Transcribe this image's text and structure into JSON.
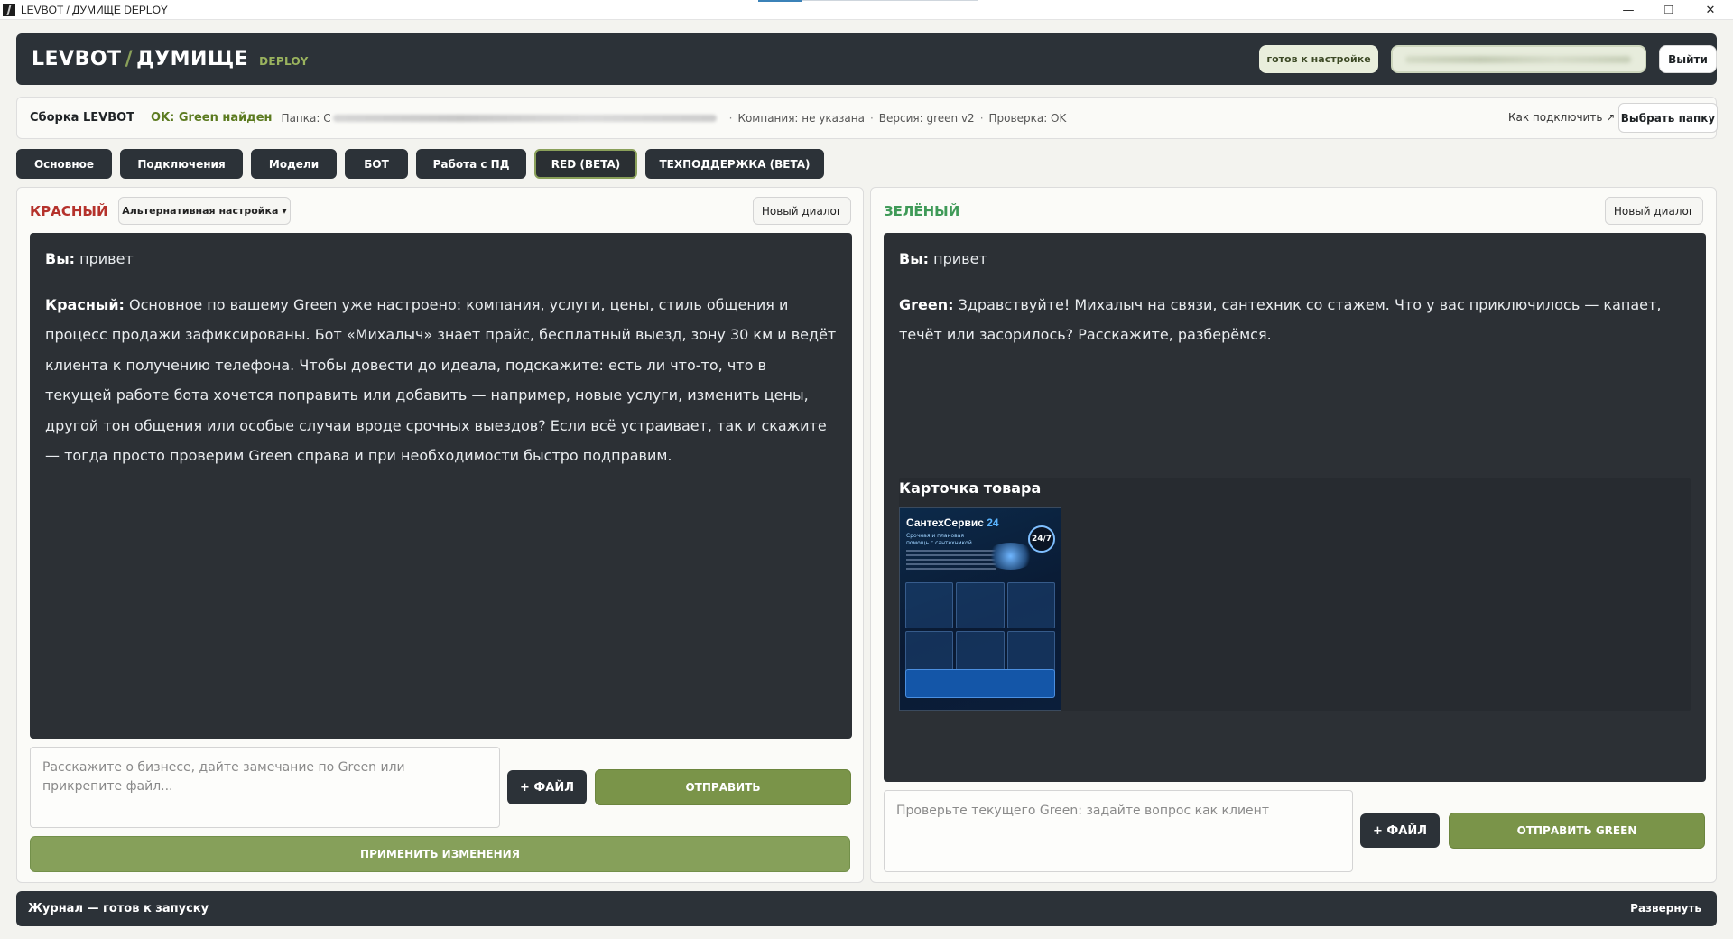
{
  "window": {
    "title": "LEVBOT / ДУМИЩЕ DEPLOY",
    "minimize": "—",
    "restore": "❐",
    "close": "✕"
  },
  "header": {
    "brand_left": "LEVBOT",
    "brand_slash": "/",
    "brand_right": "ДУМИЩЕ",
    "tag": "DEPLOY",
    "status": "готов к настройке",
    "logout": "Выйти"
  },
  "build": {
    "title": "Сборка LEVBOT",
    "ok": "OK: Green найден",
    "folder_label": "Папка: C",
    "company": "Компания: не указана",
    "version": "Версия: green v2",
    "check": "Проверка: OK",
    "how_link": "Как подключить ↗",
    "pick_folder": "Выбрать папку"
  },
  "tabs": [
    {
      "label": "Основное"
    },
    {
      "label": "Подключения"
    },
    {
      "label": "Модели"
    },
    {
      "label": "БОТ"
    },
    {
      "label": "Работа с ПД"
    },
    {
      "label": "RED (BETA)"
    },
    {
      "label": "ТЕХПОДДЕРЖКА (BETA)"
    }
  ],
  "red_panel": {
    "title": "КРАСНЫЙ",
    "alt_setting": "Альтернативная настройка ▾",
    "new_dialog": "Новый диалог",
    "messages": [
      {
        "speaker": "Вы:",
        "text": " привет"
      },
      {
        "speaker": "Красный:",
        "text": " Основное по вашему Green уже настроено: компания, услуги, цены, стиль общения и процесс продажи зафиксированы. Бот «Михалыч» знает прайс, бесплатный выезд, зону 30 км и ведёт клиента к получению телефона. Чтобы довести до идеала, подскажите: есть ли что-то, что в текущей работе бота хочется поправить или добавить — например, новые услуги, изменить цены, другой тон общения или особые случаи вроде срочных выездов? Если всё устраивает, так и скажите — тогда просто проверим Green справа и при необходимости быстро подправим."
      }
    ],
    "input_placeholder": "Расскажите о бизнесе, дайте замечание по Green или прикрепите файл...",
    "file_button": "+ ФАЙЛ",
    "send_button": "ОТПРАВИТЬ",
    "apply_button": "ПРИМЕНИТЬ ИЗМЕНЕНИЯ"
  },
  "green_panel": {
    "title": "ЗЕЛЁНЫЙ",
    "new_dialog": "Новый диалог",
    "messages": [
      {
        "speaker": "Вы:",
        "text": " привет"
      },
      {
        "speaker": "Green:",
        "text": " Здравствуйте! Михалыч на связи, сантехник со стажем. Что у вас приключилось — капает, течёт или засорилось? Расскажите, разберёмся."
      }
    ],
    "card_title": "Карточка товара",
    "card_image": {
      "brand": "СантехСервис",
      "brand_num": "24",
      "badge": "24/7",
      "subtitle": "Срочная и плановая помощь с сантехникой"
    },
    "input_placeholder": "Проверьте текущего Green: задайте вопрос как клиент",
    "file_button": "+ ФАЙЛ",
    "send_button": "ОТПРАВИТЬ GREEN"
  },
  "journal": {
    "title": "Журнал — готов к запуску",
    "expand": "Развернуть"
  }
}
